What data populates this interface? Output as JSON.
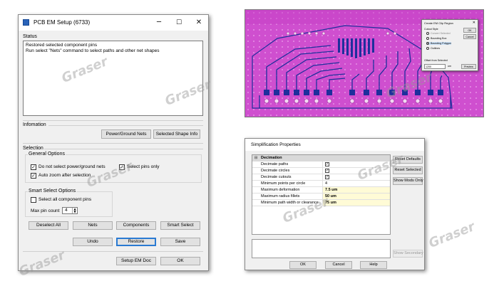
{
  "em_setup": {
    "title": "PCB EM Setup (6733)",
    "status": {
      "label": "Status",
      "lines": [
        "Restored selected component pins",
        "Run select \"Nets\" command to select paths and other net shapes"
      ]
    },
    "information": {
      "label": "Infomation",
      "power_ground_nets": "Power/Ground Nets",
      "selected_shape_info": "Selected Shape Info"
    },
    "selection": {
      "label": "Selection",
      "general_options": "General Options",
      "do_not_select_power": "Do not select power/ground nets",
      "select_pins_only": "Select pins only",
      "auto_zoom": "Auto zoom after selection",
      "smart_select_options": "Smart Select Options",
      "select_all_component_pins": "Select all component pins",
      "max_pin_count_label": "Max pin count",
      "max_pin_count_value": "4",
      "deselect_all": "Deselect All",
      "nets": "Nets",
      "components": "Components",
      "smart_select": "Smart Select"
    },
    "actions": {
      "undo": "Undo",
      "restore": "Restore",
      "save": "Save"
    },
    "footer": {
      "setup_em_doc": "Setup EM Doc",
      "ok": "OK"
    }
  },
  "clip_region": {
    "title": "Create EM Clip Region",
    "cutout_style": "Cutout Style",
    "options": [
      "Convert Selected",
      "Bounding Box",
      "Bounding Polygon",
      "Outlines"
    ],
    "selected_option": "Bounding Polygon",
    "ok": "OK",
    "cancel": "Cancel",
    "offset_label": "Offset from Selected",
    "offset_value": "1200",
    "offset_unit": "um",
    "preview": "Preview"
  },
  "simplification": {
    "title": "Simplification Properties",
    "section": "Decimation",
    "rows": [
      {
        "key": "Decimate paths",
        "value": "✓"
      },
      {
        "key": "Decimate circles",
        "value": "✓"
      },
      {
        "key": "Decimate cutouts",
        "value": "✓"
      },
      {
        "key": "Minimum points per circle",
        "value": "4"
      },
      {
        "key": "Maximum deformation",
        "value": "7.5 um"
      },
      {
        "key": "Maximum radius fillets",
        "value": "50 um"
      },
      {
        "key": "Minimum path width or clearance",
        "value": "75 um"
      }
    ],
    "side_buttons": [
      "Reset Defaults",
      "Reset Selected",
      "Show Mods Only"
    ],
    "show_secondary": "Show Secondary",
    "ok": "OK",
    "cancel": "Cancel",
    "help": "Help"
  },
  "watermark": "Graser",
  "colors": {
    "pcb_background": "#cf4fcf",
    "trace": "#1e2f9c",
    "default_button_border": "#2a7ad2",
    "highlight_value": "#fffbd6"
  }
}
